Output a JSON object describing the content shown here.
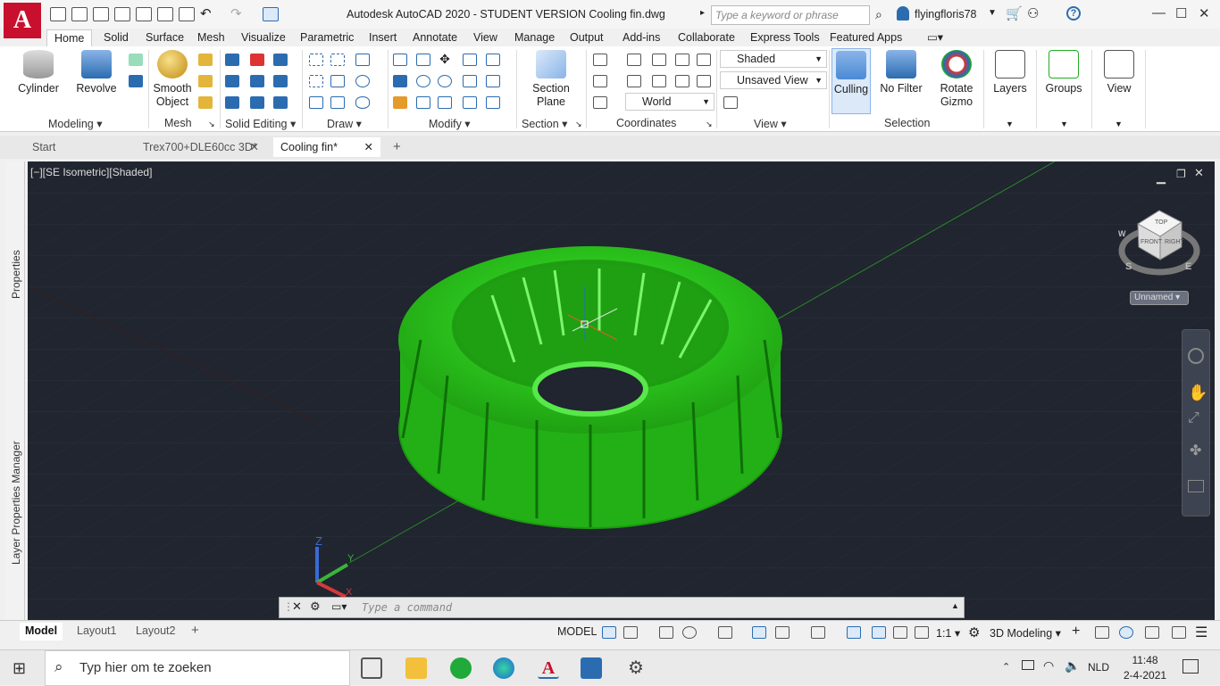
{
  "app": {
    "title": "Autodesk AutoCAD 2020 - STUDENT VERSION    Cooling fin.dwg",
    "logo": "A",
    "search_placeholder": "Type a keyword or phrase",
    "user": "flyingfloris78"
  },
  "ribbon_tabs": [
    "Home",
    "Solid",
    "Surface",
    "Mesh",
    "Visualize",
    "Parametric",
    "Insert",
    "Annotate",
    "View",
    "Manage",
    "Output",
    "Add-ins",
    "Collaborate",
    "Express Tools",
    "Featured Apps"
  ],
  "panels": {
    "modeling": {
      "label": "Modeling",
      "cylinder": "Cylinder",
      "revolve": "Revolve"
    },
    "mesh": {
      "label": "Mesh",
      "smooth_l1": "Smooth",
      "smooth_l2": "Object"
    },
    "solid_editing": {
      "label": "Solid Editing"
    },
    "draw": {
      "label": "Draw"
    },
    "modify": {
      "label": "Modify"
    },
    "section": {
      "label": "Section",
      "plane_l1": "Section",
      "plane_l2": "Plane"
    },
    "coordinates": {
      "label": "Coordinates",
      "ucs": "World"
    },
    "view": {
      "label": "View",
      "visual_style": "Shaded",
      "saved_view": "Unsaved View"
    },
    "selection": {
      "label": "Selection",
      "culling": "Culling",
      "nofilter": "No Filter",
      "rotate_l1": "Rotate",
      "rotate_l2": "Gizmo"
    },
    "layers": "Layers",
    "groups": "Groups",
    "viewbtn": "View"
  },
  "doc_tabs": [
    "Start",
    "Trex700+DLE60cc 3D*",
    "Cooling fin*"
  ],
  "viewport": {
    "label": "[−][SE Isometric][Shaded]",
    "viewcube_top": "TOP",
    "viewcube_front": "FRONT",
    "viewcube_right": "RIGHT",
    "compass_s": "S",
    "compass_e": "E",
    "compass_w": "W",
    "ucs_named": "Unnamed",
    "axis_x": "X",
    "axis_y": "Y",
    "axis_z": "Z",
    "model_color": "#29d11a"
  },
  "palettes": {
    "properties": "Properties",
    "layers": "Layer Properties Manager"
  },
  "command": {
    "placeholder": "Type a command"
  },
  "layout_tabs": [
    "Model",
    "Layout1",
    "Layout2"
  ],
  "status": {
    "space": "MODEL",
    "scale": "1:1",
    "workspace": "3D Modeling"
  },
  "taskbar": {
    "search": "Typ hier om te zoeken",
    "lang": "NLD",
    "time": "11:48",
    "date": "2-4-2021"
  }
}
